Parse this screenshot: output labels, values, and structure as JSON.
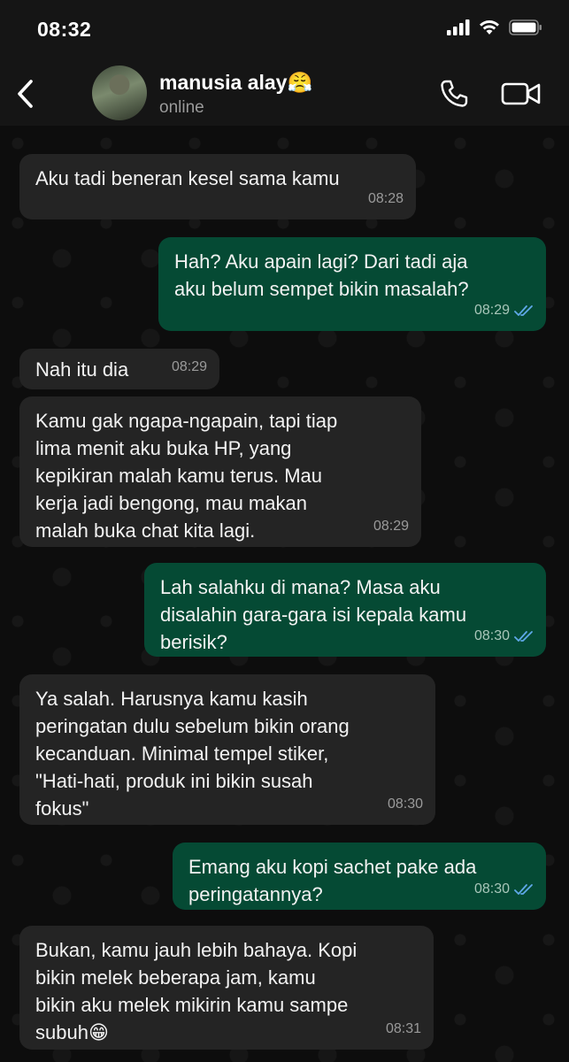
{
  "status_bar": {
    "time": "08:32"
  },
  "contact": {
    "name": "manusia alay😤",
    "status": "online"
  },
  "messages": [
    {
      "direction": "in",
      "text": "Aku tadi beneran kesel sama kamu",
      "time": "08:28"
    },
    {
      "direction": "out",
      "text": "Hah? Aku apain lagi? Dari tadi aja\naku belum sempet bikin masalah?",
      "time": "08:29",
      "read": true
    },
    {
      "direction": "in",
      "text": "Nah itu dia",
      "time": "08:29"
    },
    {
      "direction": "in",
      "text": "Kamu gak ngapa-ngapain, tapi tiap\nlima menit aku buka HP, yang\nkepikiran malah kamu terus. Mau\nkerja jadi bengong, mau makan\nmalah buka chat kita lagi.",
      "time": "08:29"
    },
    {
      "direction": "out",
      "text": "Lah salahku di mana? Masa aku\ndisalahin gara-gara isi kepala kamu\nberisik?",
      "time": "08:30",
      "read": true
    },
    {
      "direction": "in",
      "text": "Ya salah. Harusnya kamu kasih\nperingatan dulu sebelum bikin orang\nkecanduan. Minimal tempel stiker,\n\"Hati-hati, produk ini bikin susah\nfokus\"",
      "time": "08:30"
    },
    {
      "direction": "out",
      "text": "Emang aku kopi sachet pake ada\nperingatannya?",
      "time": "08:30",
      "read": true
    },
    {
      "direction": "in",
      "text": "Bukan, kamu jauh lebih bahaya. Kopi\nbikin melek beberapa jam, kamu\nbikin aku melek mikirin kamu sampe\nsubuh😁",
      "time": "08:31"
    }
  ],
  "colors": {
    "incoming_bubble": "#242424",
    "outgoing_bubble": "#054a34",
    "read_ticks": "#5fa8e8",
    "header": "#151515"
  },
  "icons": [
    "back-icon",
    "phone-icon",
    "video-call-icon",
    "signal-icon",
    "wifi-icon",
    "battery-icon",
    "double-check-icon"
  ]
}
